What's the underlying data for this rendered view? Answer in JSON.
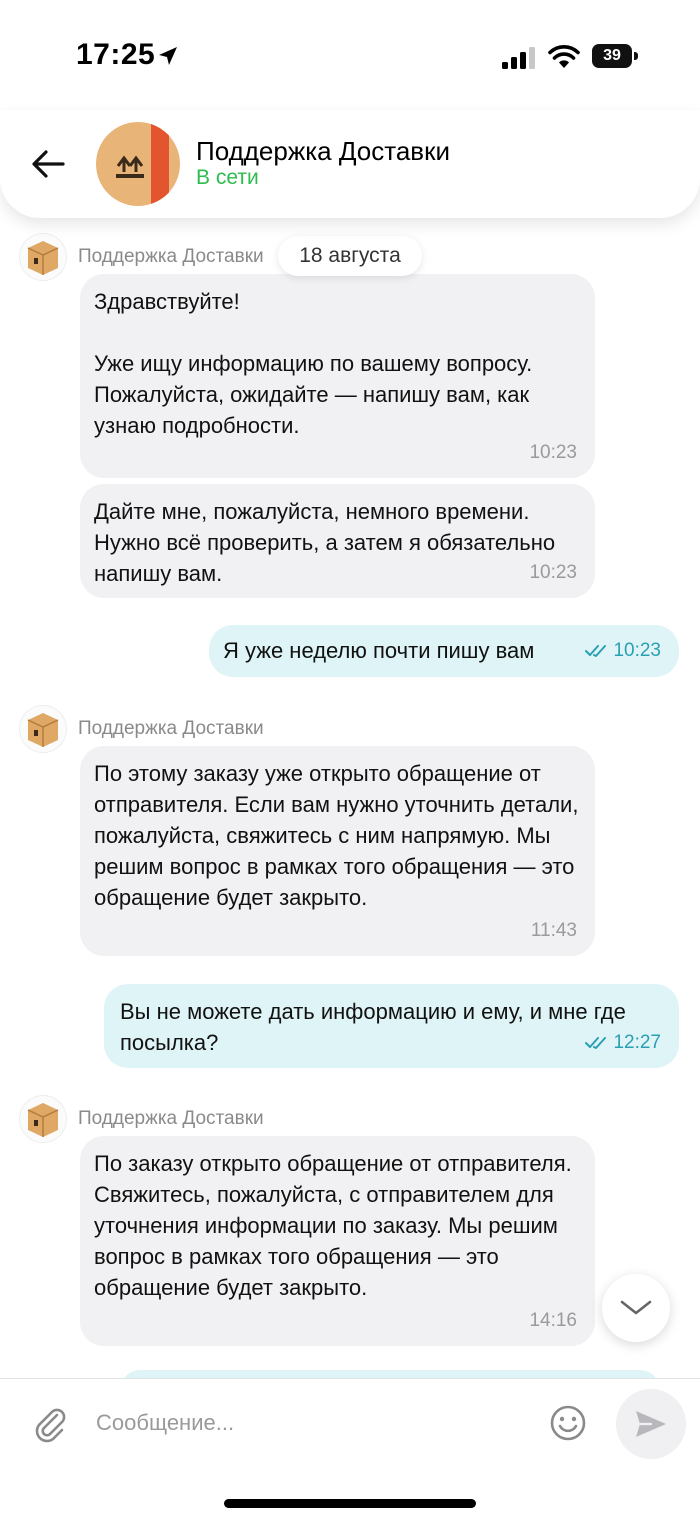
{
  "status_bar": {
    "time": "17:25",
    "battery": "39"
  },
  "header": {
    "title": "Поддержка Доставки",
    "status": "В сети",
    "status_color": "#2dbc4e"
  },
  "chat": {
    "date_separator": "18 августа",
    "messages": [
      {
        "direction": "in",
        "sender": "Поддержка Доставки",
        "text": "Здравствуйте!\n\nУже ищу информацию по вашему вопросу. Пожалуйста, ожидайте — напишу вам, как узнаю подробности.",
        "time": "10:23"
      },
      {
        "direction": "in",
        "text": "Дайте мне, пожалуйста, немного времени. Нужно всё проверить, а затем я обязательно напишу вам.",
        "time": "10:23"
      },
      {
        "direction": "out",
        "text": "Я уже неделю почти пишу вам",
        "time": "10:23",
        "read": true
      },
      {
        "direction": "in",
        "sender": "Поддержка Доставки",
        "text": "По этому заказу уже открыто обращение от отправителя. Если вам нужно уточнить детали, пожалуйста, свяжитесь с ним напрямую. Мы решим вопрос в рамках того обращения — это обращение будет закрыто.",
        "time": "11:43"
      },
      {
        "direction": "out",
        "text": "Вы не можете дать информацию и ему, и мне где посылка?",
        "time": "12:27",
        "read": true
      },
      {
        "direction": "in",
        "sender": "Поддержка Доставки",
        "text": "По заказу открыто обращение от отправителя. Свяжитесь, пожалуйста, с отправителем для уточнения информации по заказу. Мы решим вопрос в рамках того обращения — это обращение будет закрыто.",
        "time": "14:16"
      }
    ]
  },
  "composer": {
    "placeholder": "Сообщение..."
  },
  "colors": {
    "incoming_bubble": "#f1f1f3",
    "outgoing_bubble": "#dff4f7",
    "outgoing_time": "#2a9fb4"
  }
}
